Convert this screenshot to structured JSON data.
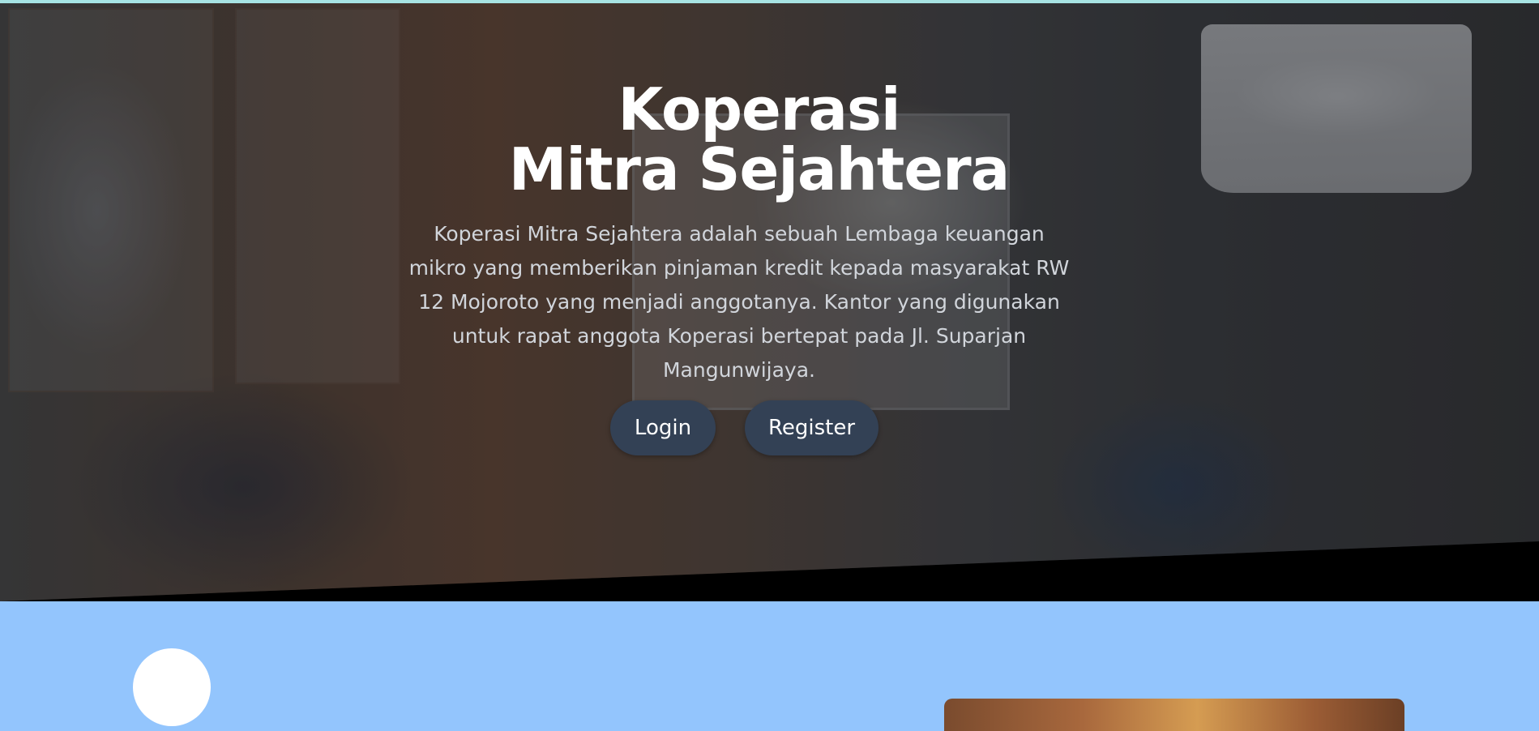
{
  "hero": {
    "title_line_1": "Koperasi",
    "title_line_2": "Mitra Sejahtera",
    "description": "Koperasi Mitra Sejahtera adalah sebuah Lembaga keuangan mikro yang memberikan pinjaman kredit kepada masyarakat RW 12 Mojoroto yang menjadi anggotanya. Kantor yang digunakan untuk rapat anggota Koperasi bertepat pada Jl. Suparjan Mangunwijaya.",
    "buttons": {
      "login_label": "Login",
      "register_label": "Register"
    }
  },
  "colors": {
    "button_bg": "#334155",
    "section_bg": "#93c5fd",
    "title_text": "#ffffff",
    "description_text": "#d1d5db"
  }
}
